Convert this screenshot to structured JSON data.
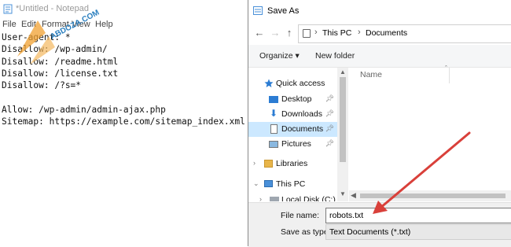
{
  "notepad": {
    "title": "*Untitled - Notepad",
    "menu": [
      "File",
      "Edit",
      "Format",
      "View",
      "Help"
    ],
    "content": "User-agent: *\nDisallow: /wp-admin/\nDisallow: /readme.html\nDisallow: /license.txt\nDisallow: /?s=*\n\nAllow: /wp-admin/admin-ajax.php\nSitemap: https://example.com/sitemap_index.xml"
  },
  "watermark": {
    "text": "ABDOZA.COM"
  },
  "dialog": {
    "title": "Save As",
    "nav": {
      "back": "←",
      "forward": "→",
      "up": "↑"
    },
    "breadcrumb": [
      "This PC",
      "Documents"
    ],
    "toolbar": {
      "organize": "Organize",
      "new_folder": "New folder"
    },
    "navpane": {
      "quick_access": "Quick access",
      "desktop": "Desktop",
      "downloads": "Downloads",
      "documents": "Documents",
      "pictures": "Pictures",
      "libraries": "Libraries",
      "this_pc": "This PC",
      "local_disk": "Local Disk (C:)"
    },
    "filelist": {
      "col_name": "Name"
    },
    "file_name_label": "File name:",
    "file_name_value": "robots.txt",
    "save_as_type_label": "Save as type:",
    "save_as_type_value": "Text Documents (*.txt)"
  },
  "colors": {
    "selected": "#cce8ff",
    "arrow": "#d9403a",
    "watermark": "#f0a030"
  }
}
